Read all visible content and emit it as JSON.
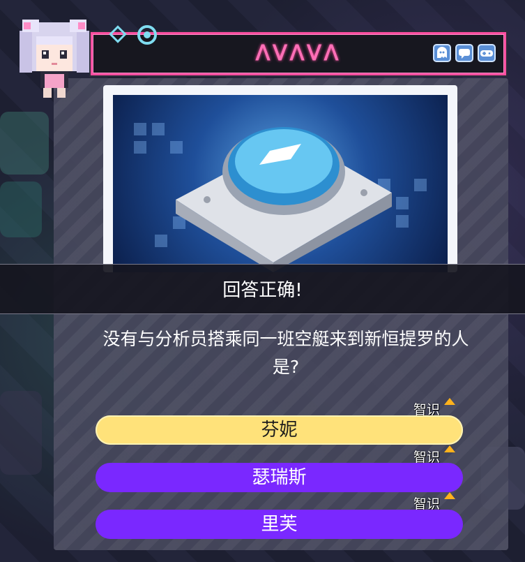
{
  "header": {
    "title": "ᐱᐯᐱᐯᐱ",
    "icons": [
      "ghost-icon",
      "chat-icon",
      "gamepad-icon"
    ],
    "accent_color": "#ff4fa0"
  },
  "result": {
    "text": "回答正确!"
  },
  "question": {
    "text": "没有与分析员搭乘同一班空艇来到新恒提罗的人是?"
  },
  "options": [
    {
      "label": "芬妮",
      "tag": "智识",
      "state": "correct",
      "color": "#ffe27a"
    },
    {
      "label": "瑟瑞斯",
      "tag": "智识",
      "state": "normal",
      "color": "#7a28ff"
    },
    {
      "label": "里芙",
      "tag": "智识",
      "state": "normal",
      "color": "#7a28ff"
    }
  ]
}
